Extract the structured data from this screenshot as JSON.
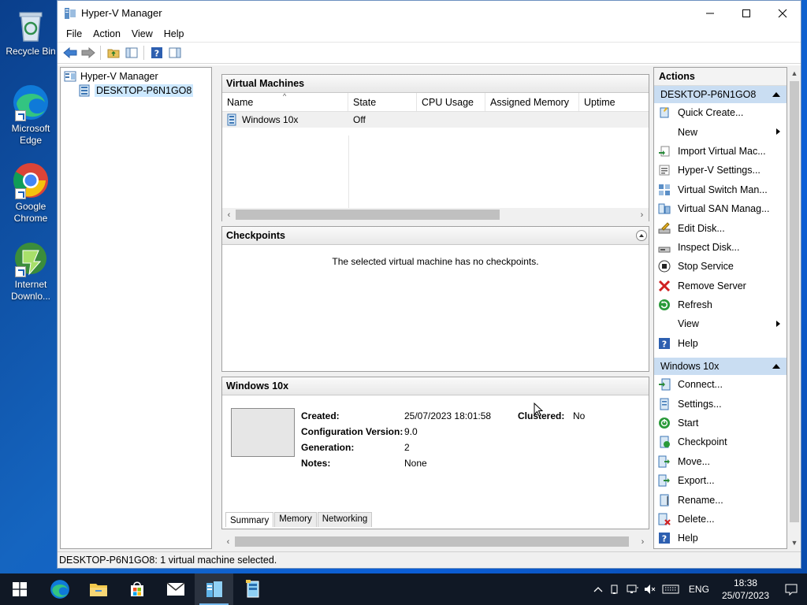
{
  "desktop": {
    "icons": [
      {
        "label": "Recycle Bin"
      },
      {
        "label": "Microsoft Edge"
      },
      {
        "label": "Google Chrome"
      },
      {
        "label": "Internet Downlo..."
      }
    ]
  },
  "window": {
    "title": "Hyper-V Manager",
    "menu": [
      "File",
      "Action",
      "View",
      "Help"
    ],
    "tree": {
      "root": "Hyper-V Manager",
      "server": "DESKTOP-P6N1GO8"
    },
    "vm_panel": {
      "title": "Virtual Machines",
      "columns": [
        "Name",
        "State",
        "CPU Usage",
        "Assigned Memory",
        "Uptime"
      ],
      "rows": [
        {
          "name": "Windows 10x",
          "state": "Off",
          "cpu": "",
          "memory": "",
          "uptime": ""
        }
      ]
    },
    "checkpoints": {
      "title": "Checkpoints",
      "message": "The selected virtual machine has no checkpoints."
    },
    "details": {
      "title": "Windows 10x",
      "created_label": "Created:",
      "created_value": "25/07/2023 18:01:58",
      "clustered_label": "Clustered:",
      "clustered_value": "No",
      "config_label": "Configuration Version:",
      "config_value": "9.0",
      "generation_label": "Generation:",
      "generation_value": "2",
      "notes_label": "Notes:",
      "notes_value": "None",
      "tabs": [
        "Summary",
        "Memory",
        "Networking"
      ]
    },
    "actions": {
      "title": "Actions",
      "server_section": "DESKTOP-P6N1GO8",
      "server_items": [
        {
          "label": "Quick Create...",
          "icon": "quick-create-icon"
        },
        {
          "label": "New",
          "icon": "none",
          "submenu": true
        },
        {
          "label": "Import Virtual Mac...",
          "icon": "import-icon"
        },
        {
          "label": "Hyper-V Settings...",
          "icon": "settings-icon"
        },
        {
          "label": "Virtual Switch Man...",
          "icon": "switch-icon"
        },
        {
          "label": "Virtual SAN Manag...",
          "icon": "san-icon"
        },
        {
          "label": "Edit Disk...",
          "icon": "edit-disk-icon"
        },
        {
          "label": "Inspect Disk...",
          "icon": "inspect-disk-icon"
        },
        {
          "label": "Stop Service",
          "icon": "stop-icon"
        },
        {
          "label": "Remove Server",
          "icon": "remove-icon"
        },
        {
          "label": "Refresh",
          "icon": "refresh-icon"
        },
        {
          "label": "View",
          "icon": "none",
          "submenu": true
        },
        {
          "label": "Help",
          "icon": "help-icon"
        }
      ],
      "vm_section": "Windows 10x",
      "vm_items": [
        {
          "label": "Connect...",
          "icon": "connect-icon"
        },
        {
          "label": "Settings...",
          "icon": "vm-settings-icon"
        },
        {
          "label": "Start",
          "icon": "start-icon"
        },
        {
          "label": "Checkpoint",
          "icon": "checkpoint-icon"
        },
        {
          "label": "Move...",
          "icon": "move-icon"
        },
        {
          "label": "Export...",
          "icon": "export-icon"
        },
        {
          "label": "Rename...",
          "icon": "rename-icon"
        },
        {
          "label": "Delete...",
          "icon": "delete-icon"
        },
        {
          "label": "Help",
          "icon": "help-icon"
        }
      ]
    },
    "status": "DESKTOP-P6N1GO8:  1 virtual machine selected."
  },
  "taskbar": {
    "language": "ENG",
    "time": "18:38",
    "date": "25/07/2023"
  },
  "colors": {
    "selection": "#cce8ff",
    "section_header": "#c9ddf2",
    "taskbar": "#101825",
    "accent": "#1a5fb4"
  }
}
